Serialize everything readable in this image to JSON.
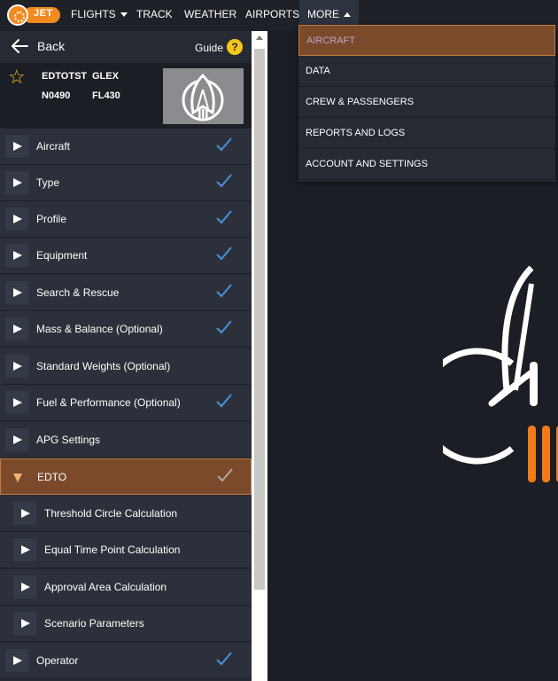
{
  "logo": {
    "text": "JET",
    "color": "#f28a22"
  },
  "nav": {
    "flights": "FLIGHTS",
    "track": "TRACK",
    "weather": "WEATHER",
    "airports": "AIRPORTS",
    "more": "MORE"
  },
  "sidebar": {
    "back_label": "Back",
    "guide_label": "Guide",
    "guide_icon": "?",
    "flight": {
      "id": "EDTOTST",
      "type": "GLEX",
      "speed": "N0490",
      "level": "FL430"
    },
    "items": [
      {
        "label": "Aircraft",
        "checked": true
      },
      {
        "label": "Type",
        "checked": true
      },
      {
        "label": "Profile",
        "checked": true
      },
      {
        "label": "Equipment",
        "checked": true
      },
      {
        "label": "Search & Rescue",
        "checked": true
      },
      {
        "label": "Mass & Balance (Optional)",
        "checked": true
      },
      {
        "label": "Standard Weights (Optional)",
        "checked": false
      },
      {
        "label": "Fuel & Performance (Optional)",
        "checked": true
      },
      {
        "label": "APG Settings",
        "checked": false
      },
      {
        "label": "EDTO",
        "checked": true,
        "expanded": true
      },
      {
        "label": "Threshold Circle Calculation",
        "checked": false,
        "sub": true
      },
      {
        "label": "Equal Time Point Calculation",
        "checked": false,
        "sub": true
      },
      {
        "label": "Approval Area Calculation",
        "checked": false,
        "sub": true
      },
      {
        "label": "Scenario Parameters",
        "checked": false,
        "sub": true
      },
      {
        "label": "Operator",
        "checked": true
      }
    ]
  },
  "more_menu": {
    "items": [
      "AIRCRAFT",
      "DATA",
      "CREW & PASSENGERS",
      "REPORTS AND LOGS",
      "ACCOUNT AND SETTINGS"
    ],
    "selected": "AIRCRAFT"
  },
  "colors": {
    "accent": "#f28a22",
    "active_row": "#7a4a2a",
    "check": "#4a90d9",
    "star": "#f5c518"
  }
}
